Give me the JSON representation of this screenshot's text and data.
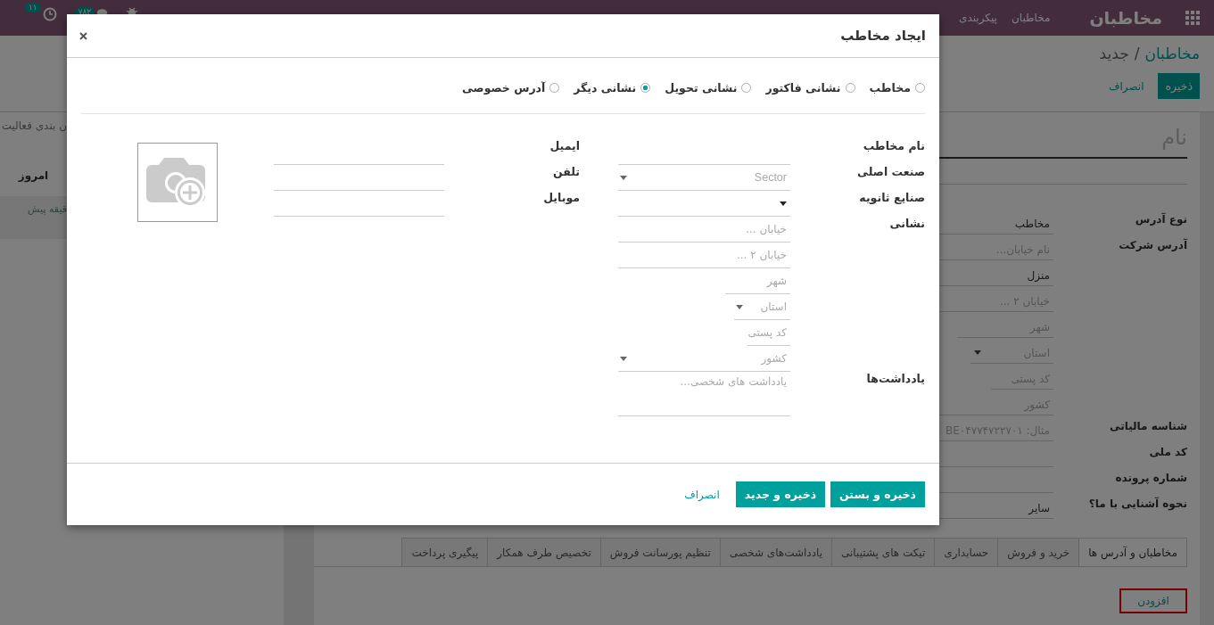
{
  "navbar": {
    "brand": "مخاطبان",
    "menu": [
      {
        "label": "مخاطبان"
      },
      {
        "label": "پیکربندی"
      }
    ],
    "activity_count": "۱۱",
    "message_count": "۷۸۲"
  },
  "breadcrumb": {
    "parent": "مخاطبان",
    "separator": "/",
    "current": "جدید"
  },
  "actions": {
    "save": "ذخیره",
    "discard": "انصراف"
  },
  "chatter": {
    "schedule": "ن بندی فعالیت",
    "date_separator": "امروز",
    "message_time": "قیقه پیش"
  },
  "form": {
    "name_placeholder": "نام",
    "fields": [
      {
        "label": "نوع آدرس",
        "kind": "text",
        "value": "مخاطب"
      },
      {
        "label": "آدرس شرکت",
        "kind": "text",
        "placeholder": "نام خیابان..."
      },
      {
        "kind": "text",
        "value": "منزل"
      },
      {
        "kind": "text",
        "placeholder": "خیابان ۲ ..."
      },
      {
        "kind": "city",
        "placeholder": "شهر"
      },
      {
        "kind": "state",
        "placeholder": "استان"
      },
      {
        "kind": "zip",
        "placeholder": "کد پستی"
      },
      {
        "kind": "text",
        "placeholder": "کشور"
      },
      {
        "label": "شناسه مالیاتی",
        "kind": "text",
        "placeholder": "مثال: BE۰۴۷۷۴۷۲۲۷۰۱"
      },
      {
        "label": "کد ملی",
        "kind": "text"
      },
      {
        "label": "شماره پرونده",
        "kind": "text"
      },
      {
        "label": "نحوه آشنایی با ما؟",
        "kind": "text",
        "value": "سایر"
      }
    ],
    "tabs": [
      {
        "label": "مخاطبان و آدرس ها",
        "selected": true
      },
      {
        "label": "خرید و فروش",
        "selected": false
      },
      {
        "label": "حسابداری",
        "selected": false
      },
      {
        "label": "تیکت های پشتیبانی",
        "selected": false
      },
      {
        "label": "یادداشت‌های شخصی",
        "selected": false
      },
      {
        "label": "تنظیم پورسانت فروش",
        "selected": false
      },
      {
        "label": "تخصیص طرف همکار",
        "selected": false
      },
      {
        "label": "پیگیری پرداخت",
        "selected": false
      }
    ],
    "add_line": "افزودن"
  },
  "dialog": {
    "title": "ایجاد مخاطب",
    "address_types": [
      {
        "label": "مخاطب",
        "selected": false
      },
      {
        "label": "نشانی فاکتور",
        "selected": false
      },
      {
        "label": "نشانی تحویل",
        "selected": false
      },
      {
        "label": "نشانی دیگر",
        "selected": true
      },
      {
        "label": "آدرس خصوصی",
        "selected": false
      }
    ],
    "fields": [
      {
        "label": "نام مخاطب",
        "kind": "text"
      },
      {
        "label": "صنعت اصلی",
        "kind": "select",
        "placeholder": "Sector"
      },
      {
        "label": "صنایع ثانویه",
        "kind": "select"
      },
      {
        "label": "نشانی",
        "kind": "address",
        "lines": [
          {
            "kind": "full",
            "placeholder": "خیابان ..."
          },
          {
            "kind": "full",
            "placeholder": "خیابان ۲ ..."
          },
          {
            "kind": "city",
            "placeholder": "شهر"
          },
          {
            "kind": "state",
            "placeholder": "استان"
          },
          {
            "kind": "zip",
            "placeholder": "کد پستی"
          },
          {
            "kind": "country",
            "placeholder": "کشور"
          }
        ]
      },
      {
        "label": "یادداشت‌ها",
        "kind": "textarea",
        "placeholder": "یادداشت های شخصی..."
      }
    ],
    "contact_fields": [
      {
        "label": "ایمیل"
      },
      {
        "label": "تلفن"
      },
      {
        "label": "موبایل"
      }
    ],
    "buttons": [
      {
        "label": "ذخیره و بستن",
        "kind": "primary"
      },
      {
        "label": "ذخیره و جدید",
        "kind": "primary"
      },
      {
        "label": "انصراف",
        "kind": "link"
      }
    ]
  }
}
